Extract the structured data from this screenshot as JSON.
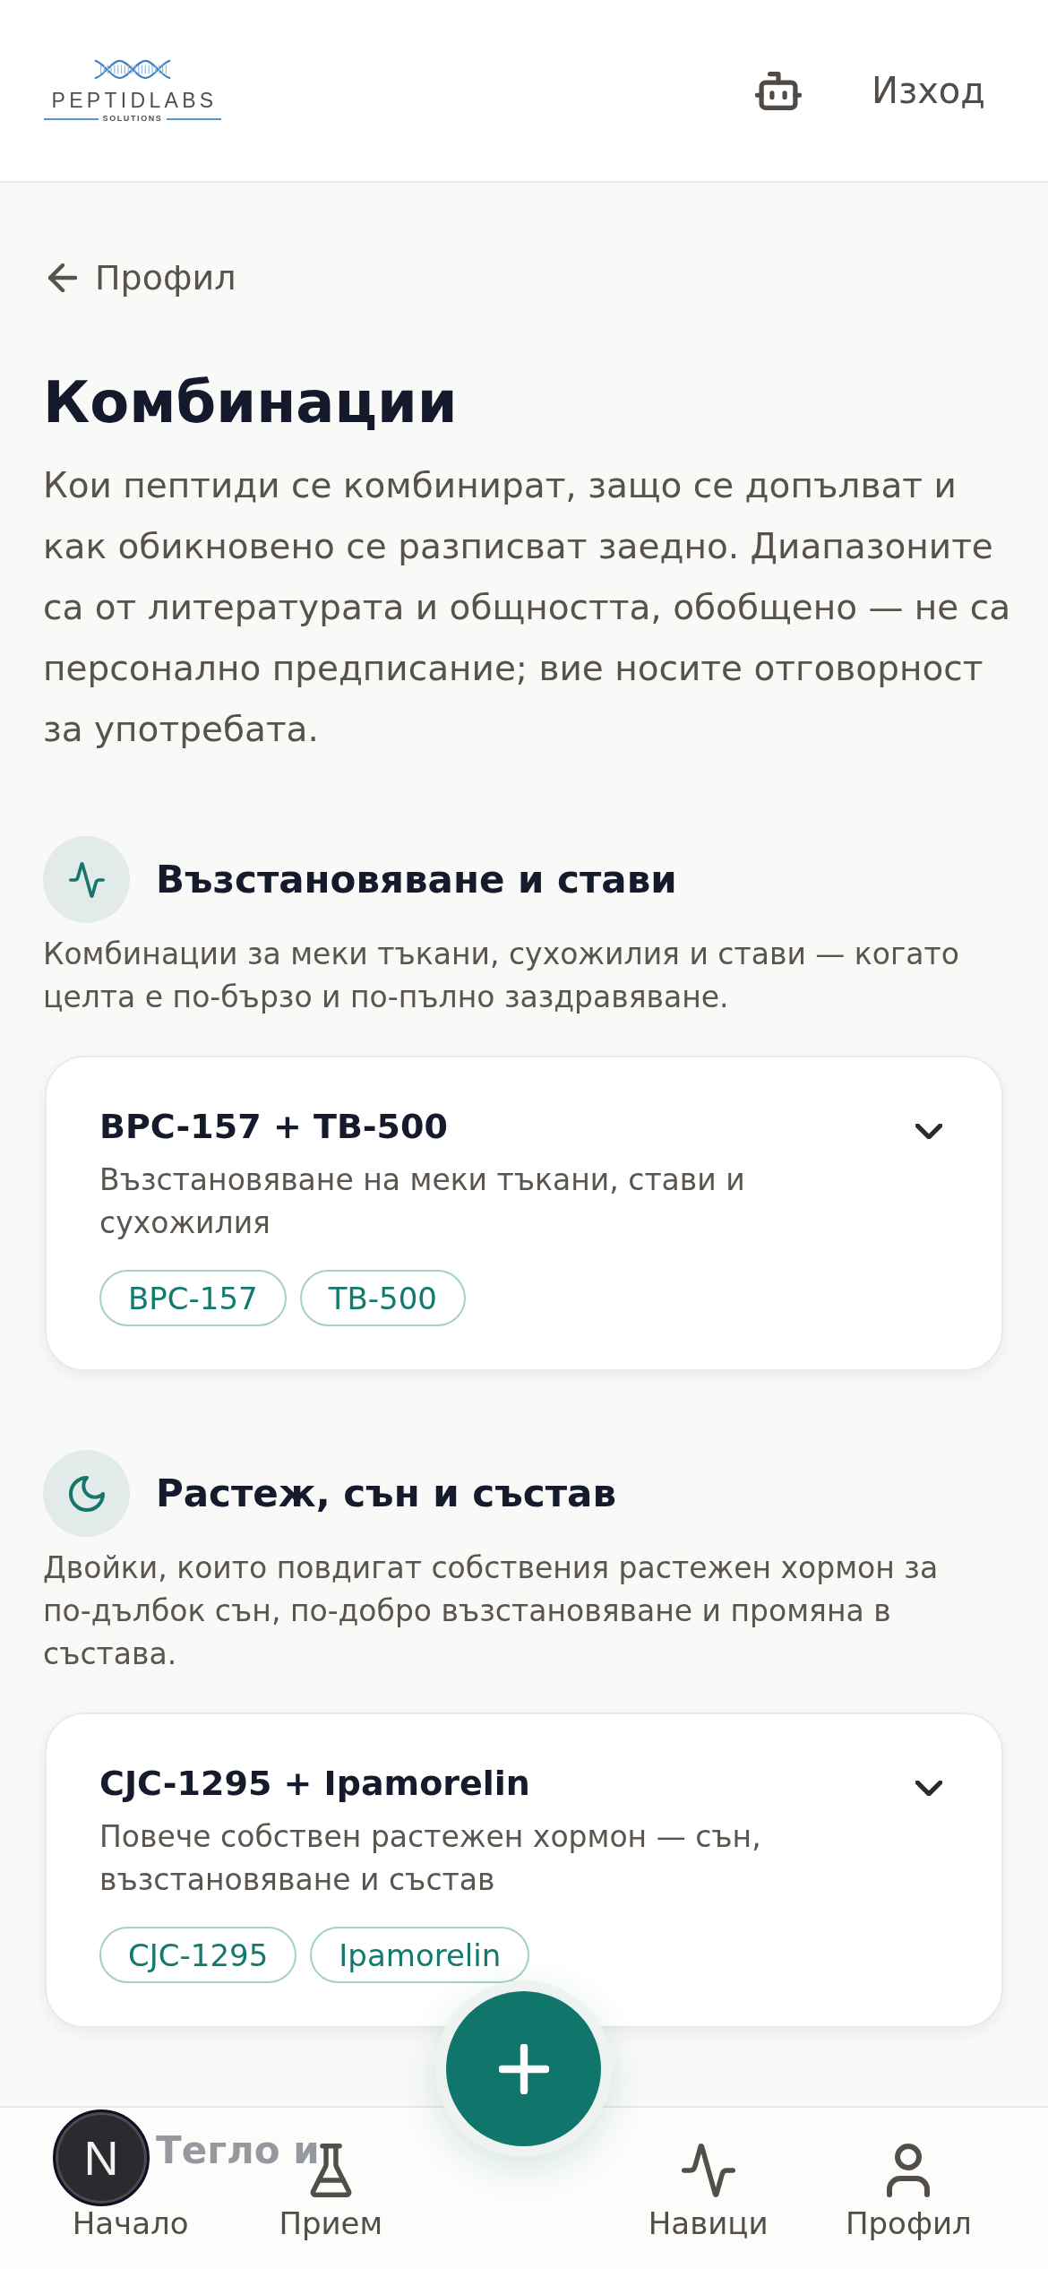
{
  "header": {
    "logo": {
      "name": "PEPTIDLABS",
      "tagline": "SOLUTIONS"
    },
    "logout": "Изход"
  },
  "back": {
    "label": "Профил"
  },
  "title": "Комбинации",
  "intro": "Кои пептиди се комбинират, защо се допълват и как обикновено се разписват заедно. Диапазоните са от литературата и общността, обобщено — не са персонално предписание; вие носите отговорност за употребата.",
  "sections": [
    {
      "kind": "recovery",
      "heading": "Възстановяване и стави",
      "description": "Комбинации за меки тъкани, сухожилия и стави — когато целта е по-бързо и по-пълно заздравяване.",
      "combos": [
        {
          "title": "BPC-157 + TB-500",
          "description": "Възстановяване на меки тъкани, стави и сухожилия",
          "expanded": false,
          "tags": [
            "BPC-157",
            "TB-500"
          ]
        }
      ]
    },
    {
      "kind": "growth",
      "heading": "Растеж, сън и състав",
      "description": "Двойки, които повдигат собствения растежен хормон за по-дълбок сън, по-добро възстановяване и промяна в състава.",
      "combos": [
        {
          "title": "CJC-1295 + Ipamorelin",
          "description": "Повече собствен растежен хормон — сън, възстановяване и състав",
          "expanded": false,
          "tags": [
            "CJC-1295",
            "Ipamorelin"
          ]
        }
      ]
    },
    {
      "kind": "weight",
      "heading": "Тегло и"
    }
  ],
  "nav": [
    {
      "kind": "home",
      "label": "Начало",
      "selected": false
    },
    {
      "kind": "intake",
      "label": "Прием",
      "selected": false
    },
    {
      "kind": "habits",
      "label": "Навици",
      "selected": false
    },
    {
      "kind": "profile",
      "label": "Профил",
      "selected": false
    }
  ],
  "dev_badge": "N"
}
